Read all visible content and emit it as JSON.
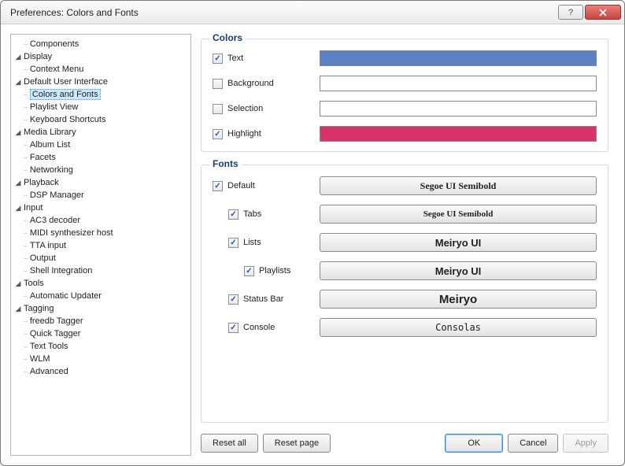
{
  "window": {
    "title": "Preferences: Colors and Fonts"
  },
  "tree": {
    "components": "Components",
    "display": "Display",
    "context_menu": "Context Menu",
    "default_ui": "Default User Interface",
    "colors_fonts": "Colors and Fonts",
    "playlist_view": "Playlist View",
    "keyboard_shortcuts": "Keyboard Shortcuts",
    "media_library": "Media Library",
    "album_list": "Album List",
    "facets": "Facets",
    "networking": "Networking",
    "playback": "Playback",
    "dsp_manager": "DSP Manager",
    "input": "Input",
    "ac3": "AC3 decoder",
    "midi": "MIDI synthesizer host",
    "tta": "TTA input",
    "output": "Output",
    "shell_integration": "Shell Integration",
    "tools": "Tools",
    "automatic_updater": "Automatic Updater",
    "tagging": "Tagging",
    "freedb": "freedb Tagger",
    "quick_tagger": "Quick Tagger",
    "text_tools": "Text Tools",
    "wlm": "WLM",
    "advanced": "Advanced"
  },
  "colors": {
    "title": "Colors",
    "text": {
      "label": "Text",
      "checked": true,
      "color": "#5b83c4"
    },
    "background": {
      "label": "Background",
      "checked": false,
      "color": "#ffffff"
    },
    "selection": {
      "label": "Selection",
      "checked": false,
      "color": "#ffffff"
    },
    "highlight": {
      "label": "Highlight",
      "checked": true,
      "color": "#d7326a"
    }
  },
  "fonts": {
    "title": "Fonts",
    "default_": {
      "label": "Default",
      "checked": true,
      "font": "Segoe UI Semibold"
    },
    "tabs": {
      "label": "Tabs",
      "checked": true,
      "font": "Segoe UI Semibold"
    },
    "lists": {
      "label": "Lists",
      "checked": true,
      "font": "Meiryo UI"
    },
    "playlists": {
      "label": "Playlists",
      "checked": true,
      "font": "Meiryo UI"
    },
    "statusbar": {
      "label": "Status Bar",
      "checked": true,
      "font": "Meiryo"
    },
    "console": {
      "label": "Console",
      "checked": true,
      "font": "Consolas"
    }
  },
  "buttons": {
    "reset_all": "Reset all",
    "reset_page": "Reset page",
    "ok": "OK",
    "cancel": "Cancel",
    "apply": "Apply"
  }
}
